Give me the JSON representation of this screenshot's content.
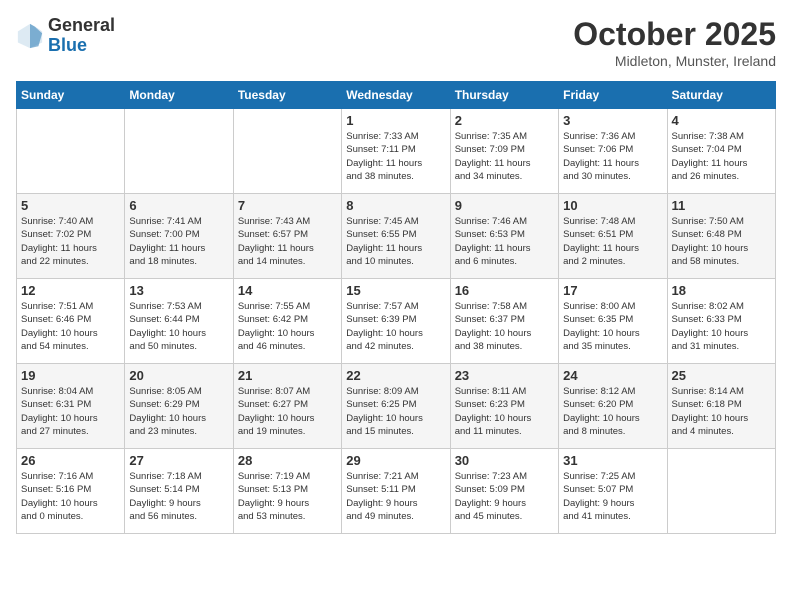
{
  "header": {
    "logo_general": "General",
    "logo_blue": "Blue",
    "month": "October 2025",
    "location": "Midleton, Munster, Ireland"
  },
  "weekdays": [
    "Sunday",
    "Monday",
    "Tuesday",
    "Wednesday",
    "Thursday",
    "Friday",
    "Saturday"
  ],
  "weeks": [
    [
      {
        "day": "",
        "info": ""
      },
      {
        "day": "",
        "info": ""
      },
      {
        "day": "",
        "info": ""
      },
      {
        "day": "1",
        "info": "Sunrise: 7:33 AM\nSunset: 7:11 PM\nDaylight: 11 hours\nand 38 minutes."
      },
      {
        "day": "2",
        "info": "Sunrise: 7:35 AM\nSunset: 7:09 PM\nDaylight: 11 hours\nand 34 minutes."
      },
      {
        "day": "3",
        "info": "Sunrise: 7:36 AM\nSunset: 7:06 PM\nDaylight: 11 hours\nand 30 minutes."
      },
      {
        "day": "4",
        "info": "Sunrise: 7:38 AM\nSunset: 7:04 PM\nDaylight: 11 hours\nand 26 minutes."
      }
    ],
    [
      {
        "day": "5",
        "info": "Sunrise: 7:40 AM\nSunset: 7:02 PM\nDaylight: 11 hours\nand 22 minutes."
      },
      {
        "day": "6",
        "info": "Sunrise: 7:41 AM\nSunset: 7:00 PM\nDaylight: 11 hours\nand 18 minutes."
      },
      {
        "day": "7",
        "info": "Sunrise: 7:43 AM\nSunset: 6:57 PM\nDaylight: 11 hours\nand 14 minutes."
      },
      {
        "day": "8",
        "info": "Sunrise: 7:45 AM\nSunset: 6:55 PM\nDaylight: 11 hours\nand 10 minutes."
      },
      {
        "day": "9",
        "info": "Sunrise: 7:46 AM\nSunset: 6:53 PM\nDaylight: 11 hours\nand 6 minutes."
      },
      {
        "day": "10",
        "info": "Sunrise: 7:48 AM\nSunset: 6:51 PM\nDaylight: 11 hours\nand 2 minutes."
      },
      {
        "day": "11",
        "info": "Sunrise: 7:50 AM\nSunset: 6:48 PM\nDaylight: 10 hours\nand 58 minutes."
      }
    ],
    [
      {
        "day": "12",
        "info": "Sunrise: 7:51 AM\nSunset: 6:46 PM\nDaylight: 10 hours\nand 54 minutes."
      },
      {
        "day": "13",
        "info": "Sunrise: 7:53 AM\nSunset: 6:44 PM\nDaylight: 10 hours\nand 50 minutes."
      },
      {
        "day": "14",
        "info": "Sunrise: 7:55 AM\nSunset: 6:42 PM\nDaylight: 10 hours\nand 46 minutes."
      },
      {
        "day": "15",
        "info": "Sunrise: 7:57 AM\nSunset: 6:39 PM\nDaylight: 10 hours\nand 42 minutes."
      },
      {
        "day": "16",
        "info": "Sunrise: 7:58 AM\nSunset: 6:37 PM\nDaylight: 10 hours\nand 38 minutes."
      },
      {
        "day": "17",
        "info": "Sunrise: 8:00 AM\nSunset: 6:35 PM\nDaylight: 10 hours\nand 35 minutes."
      },
      {
        "day": "18",
        "info": "Sunrise: 8:02 AM\nSunset: 6:33 PM\nDaylight: 10 hours\nand 31 minutes."
      }
    ],
    [
      {
        "day": "19",
        "info": "Sunrise: 8:04 AM\nSunset: 6:31 PM\nDaylight: 10 hours\nand 27 minutes."
      },
      {
        "day": "20",
        "info": "Sunrise: 8:05 AM\nSunset: 6:29 PM\nDaylight: 10 hours\nand 23 minutes."
      },
      {
        "day": "21",
        "info": "Sunrise: 8:07 AM\nSunset: 6:27 PM\nDaylight: 10 hours\nand 19 minutes."
      },
      {
        "day": "22",
        "info": "Sunrise: 8:09 AM\nSunset: 6:25 PM\nDaylight: 10 hours\nand 15 minutes."
      },
      {
        "day": "23",
        "info": "Sunrise: 8:11 AM\nSunset: 6:23 PM\nDaylight: 10 hours\nand 11 minutes."
      },
      {
        "day": "24",
        "info": "Sunrise: 8:12 AM\nSunset: 6:20 PM\nDaylight: 10 hours\nand 8 minutes."
      },
      {
        "day": "25",
        "info": "Sunrise: 8:14 AM\nSunset: 6:18 PM\nDaylight: 10 hours\nand 4 minutes."
      }
    ],
    [
      {
        "day": "26",
        "info": "Sunrise: 7:16 AM\nSunset: 5:16 PM\nDaylight: 10 hours\nand 0 minutes."
      },
      {
        "day": "27",
        "info": "Sunrise: 7:18 AM\nSunset: 5:14 PM\nDaylight: 9 hours\nand 56 minutes."
      },
      {
        "day": "28",
        "info": "Sunrise: 7:19 AM\nSunset: 5:13 PM\nDaylight: 9 hours\nand 53 minutes."
      },
      {
        "day": "29",
        "info": "Sunrise: 7:21 AM\nSunset: 5:11 PM\nDaylight: 9 hours\nand 49 minutes."
      },
      {
        "day": "30",
        "info": "Sunrise: 7:23 AM\nSunset: 5:09 PM\nDaylight: 9 hours\nand 45 minutes."
      },
      {
        "day": "31",
        "info": "Sunrise: 7:25 AM\nSunset: 5:07 PM\nDaylight: 9 hours\nand 41 minutes."
      },
      {
        "day": "",
        "info": ""
      }
    ]
  ]
}
